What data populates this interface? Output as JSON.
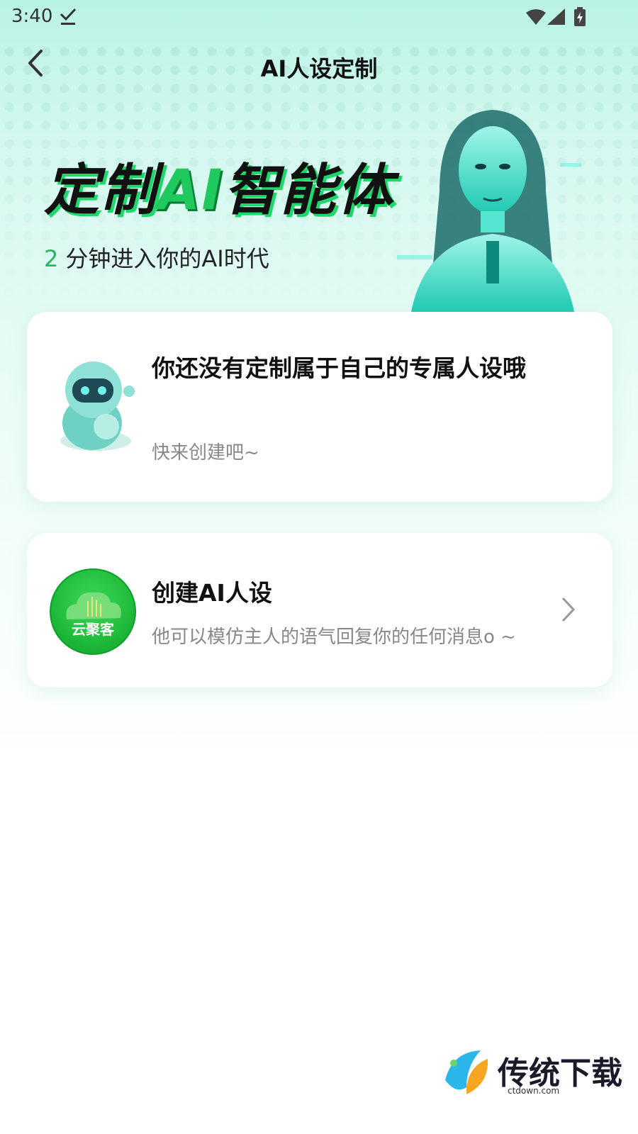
{
  "status_bar": {
    "time": "3:40"
  },
  "header": {
    "title": "AI人设定制"
  },
  "hero": {
    "title_pre": "定制",
    "title_ai": "AI",
    "title_post": "智能体",
    "subtitle_num": "2",
    "subtitle_text": "分钟进入你的AI时代"
  },
  "empty_card": {
    "title": "你还没有定制属于自己的专属人设哦",
    "subtitle": "快来创建吧~"
  },
  "create_card": {
    "logo_text": "云聚客",
    "title": "创建AI人设",
    "subtitle": "他可以模仿主人的语气回复你的任何消息o ~"
  },
  "watermark": {
    "name": "传统下载",
    "url": "ctdown.com"
  }
}
